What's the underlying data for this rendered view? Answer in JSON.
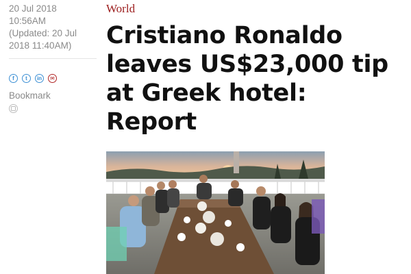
{
  "article": {
    "date_line1": "20 Jul 2018",
    "date_line2": "10:56AM",
    "updated_line1": "(Updated: 20 Jul",
    "updated_line2": "2018 11:40AM)",
    "category": "World",
    "headline": "Cristiano Ronaldo leaves US$23,000 tip at Greek hotel: Report",
    "bookmark_label": "Bookmark"
  },
  "share": [
    {
      "icon": "facebook-icon",
      "glyph": "f"
    },
    {
      "icon": "twitter-icon",
      "glyph": "t"
    },
    {
      "icon": "linkedin-icon",
      "glyph": "in"
    },
    {
      "icon": "email-icon",
      "glyph": "✉"
    }
  ],
  "photo": {
    "description_icon": "group-dinner-photo"
  },
  "colors": {
    "category": "#9b1b1b",
    "meta_text": "#8a8a8a",
    "share_icon": "#3b8fd4",
    "mail_icon": "#b02424",
    "headline": "#111111"
  }
}
